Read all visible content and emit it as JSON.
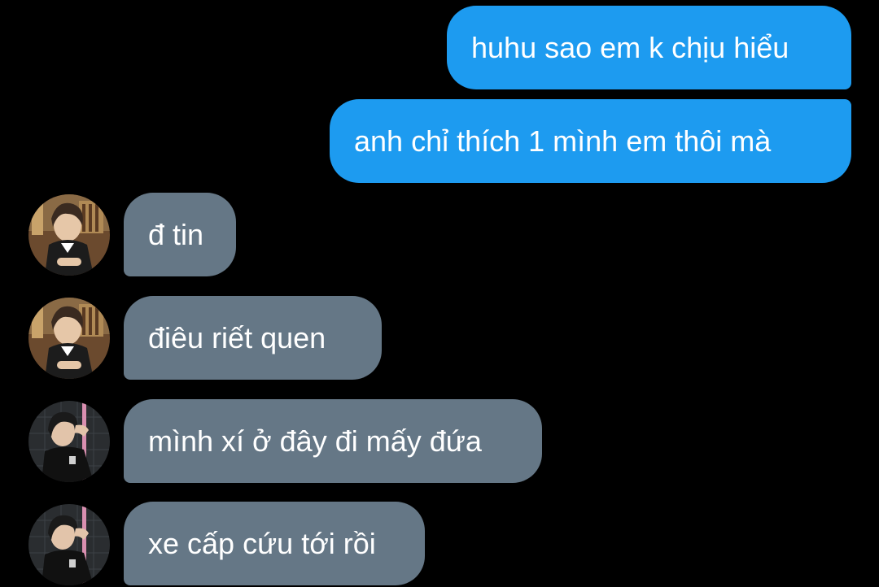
{
  "conversation": {
    "messages": [
      {
        "direction": "outgoing",
        "text": "huhu sao em k chịu hiểu"
      },
      {
        "direction": "outgoing",
        "text": "anh chỉ thích 1 mình em thôi mà"
      },
      {
        "direction": "incoming",
        "sender_avatar": "avatar-dark-blazer",
        "text": "đ tin"
      },
      {
        "direction": "incoming",
        "sender_avatar": "avatar-dark-blazer",
        "text": "điêu riết quen"
      },
      {
        "direction": "incoming",
        "sender_avatar": "avatar-black-tshirt",
        "text": "mình xí ở đây đi mấy đứa"
      },
      {
        "direction": "incoming",
        "sender_avatar": "avatar-black-tshirt",
        "text": "xe cấp cứu tới rồi"
      }
    ]
  },
  "colors": {
    "background": "#000000",
    "outgoing_bubble": "#1d9bf0",
    "incoming_bubble": "#657786",
    "text": "#ffffff"
  }
}
